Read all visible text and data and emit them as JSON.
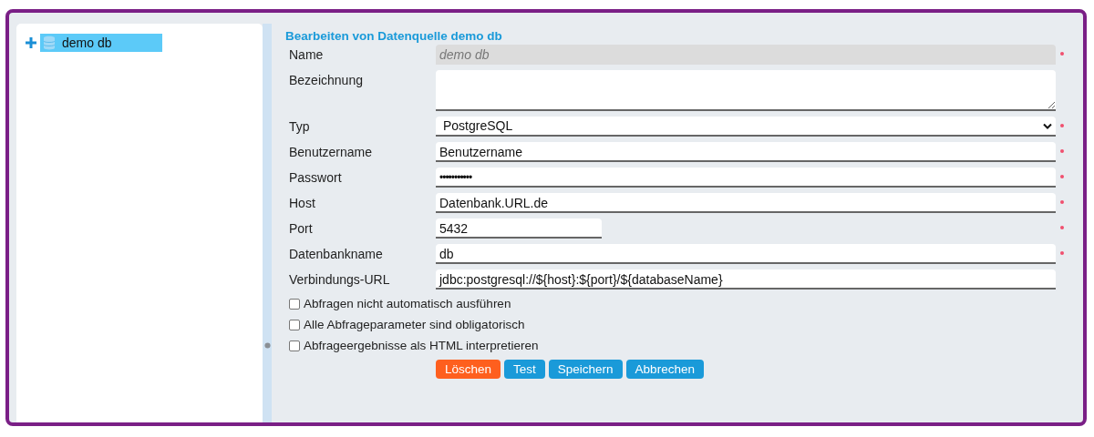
{
  "tree": {
    "items": [
      {
        "label": "demo db",
        "selected": true,
        "expanded": false
      }
    ]
  },
  "form": {
    "title": "Bearbeiten von Datenquelle demo db",
    "fields": [
      {
        "label": "Name",
        "kind": "text",
        "value": "demo db",
        "disabled": true,
        "required": true
      },
      {
        "label": "Bezeichnung",
        "kind": "textarea",
        "disabled": false,
        "required": false
      },
      {
        "label": "Typ",
        "kind": "select",
        "value": "PostgreSQL",
        "disabled": false,
        "required": true
      },
      {
        "label": "Benutzername",
        "kind": "text",
        "value": "Benutzername",
        "disabled": false,
        "required": true
      },
      {
        "label": "Passwort",
        "kind": "password",
        "value": "•••••••••••",
        "disabled": false,
        "required": true
      },
      {
        "label": "Host",
        "kind": "text",
        "value": "Datenbank.URL.de",
        "disabled": false,
        "required": true
      },
      {
        "label": "Port",
        "kind": "short-text",
        "value": "5432",
        "disabled": false,
        "required": true
      },
      {
        "label": "Datenbankname",
        "kind": "text",
        "value": "db",
        "disabled": false,
        "required": true
      },
      {
        "label": "Verbindungs-URL",
        "kind": "text",
        "value": "jdbc:postgresql://${host}:${port}/${databaseName}",
        "disabled": false,
        "required": false
      }
    ],
    "checkboxes": [
      {
        "label": "Abfragen nicht automatisch ausführen",
        "checked": false
      },
      {
        "label": "Alle Abfrageparameter sind obligatorisch",
        "checked": false
      },
      {
        "label": "Abfrageergebnisse als HTML interpretieren",
        "checked": false
      }
    ],
    "buttons": [
      {
        "label": "Löschen",
        "kind": "danger"
      },
      {
        "label": "Test",
        "kind": "primary"
      },
      {
        "label": "Speichern",
        "kind": "primary"
      },
      {
        "label": "Abbrechen",
        "kind": "primary"
      }
    ]
  }
}
